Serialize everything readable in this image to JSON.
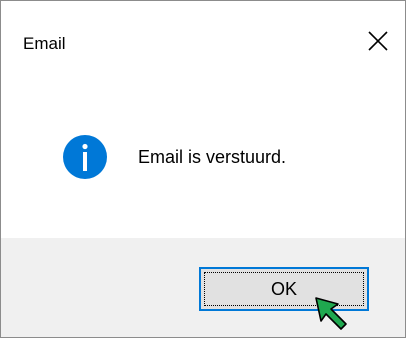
{
  "window": {
    "title": "Email",
    "close_icon": "close-icon"
  },
  "message": {
    "icon": "info-icon",
    "text": "Email is verstuurd."
  },
  "buttons": {
    "ok_label": "OK"
  },
  "colors": {
    "info_blue": "#0078d7",
    "footer_bg": "#f0f0f0",
    "button_bg": "#e1e1e1",
    "focus_border": "#0078d7",
    "cursor_green": "#1fa84f"
  }
}
